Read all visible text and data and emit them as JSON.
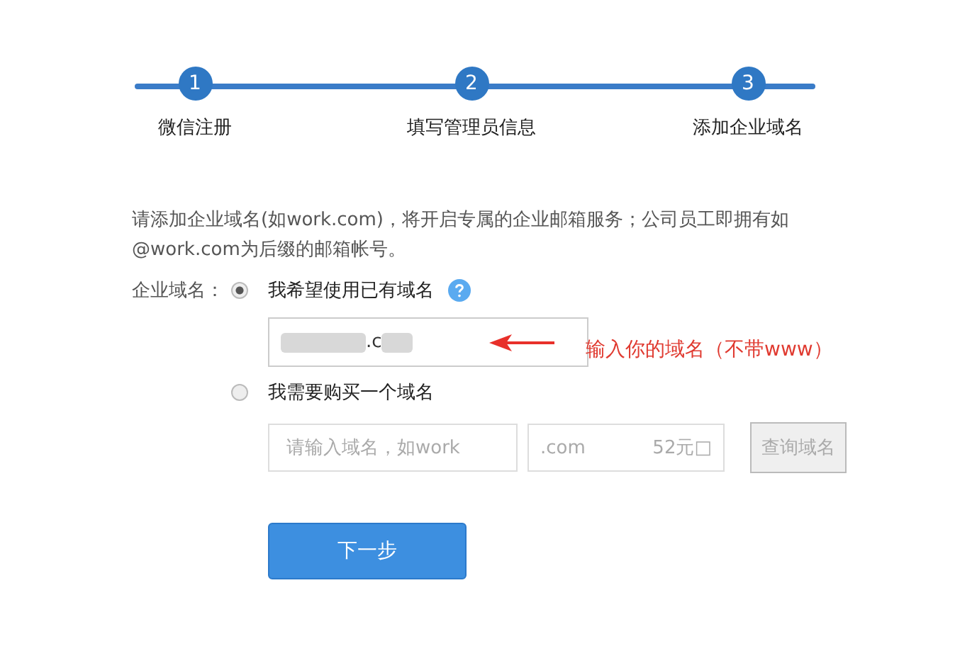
{
  "steps": [
    {
      "number": "1",
      "label": "微信注册"
    },
    {
      "number": "2",
      "label": "填写管理员信息"
    },
    {
      "number": "3",
      "label": "添加企业域名"
    }
  ],
  "intro": "请添加企业域名(如work.com)，将开启专属的企业邮箱服务；公司员工即拥有如@work.com为后缀的邮箱帐号。",
  "field_label": "企业域名：",
  "options": [
    {
      "label": "我希望使用已有域名",
      "selected": true,
      "help": true
    },
    {
      "label": "我需要购买一个域名",
      "selected": false,
      "help": false
    }
  ],
  "domain_field": {
    "value": ".c",
    "redacted": true
  },
  "annotation": "输入你的域名（不带www）",
  "buy_row": {
    "placeholder": "请输入域名，如work",
    "suffix": ".com",
    "price": "52元□",
    "button": "查询域名",
    "button_disabled": true
  },
  "next_button": "下一步"
}
